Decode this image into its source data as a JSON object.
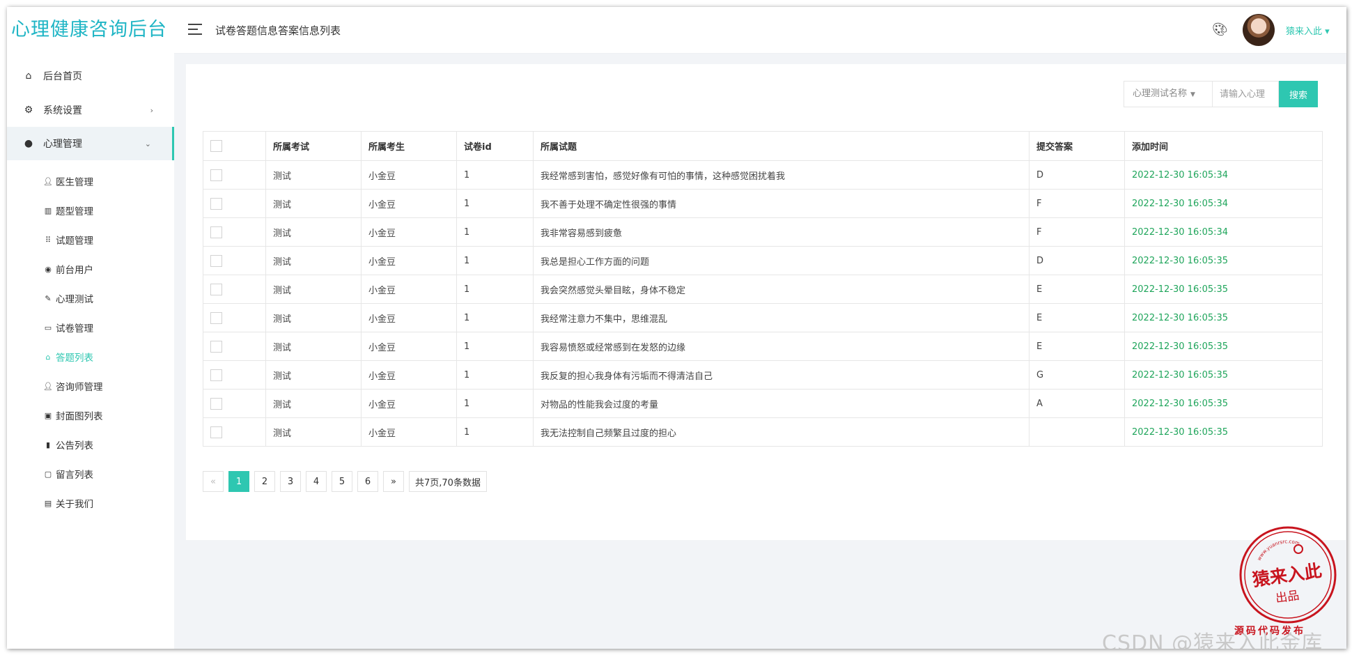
{
  "brand": "心理健康咨询后台",
  "header": {
    "page_title": "试卷答题信息答案信息列表",
    "user_name": "猿来入此 ▾"
  },
  "sidebar": {
    "items": [
      {
        "label": "后台首页",
        "icon": "home-icon"
      },
      {
        "label": "系统设置",
        "icon": "gear-icon",
        "arrow": "›"
      },
      {
        "label": "心理管理",
        "icon": "brain-icon",
        "arrow": "⌄"
      }
    ],
    "sub_items": [
      {
        "label": "医生管理",
        "icon": "user-icon"
      },
      {
        "label": "题型管理",
        "icon": "book-icon"
      },
      {
        "label": "试题管理",
        "icon": "grid-icon"
      },
      {
        "label": "前台用户",
        "icon": "user-circle-icon"
      },
      {
        "label": "心理测试",
        "icon": "pencil-icon"
      },
      {
        "label": "试卷管理",
        "icon": "clipboard-icon"
      },
      {
        "label": "答题列表",
        "icon": "list-icon"
      },
      {
        "label": "咨询师管理",
        "icon": "user-icon"
      },
      {
        "label": "封面图列表",
        "icon": "image-icon"
      },
      {
        "label": "公告列表",
        "icon": "notice-icon"
      },
      {
        "label": "留言列表",
        "icon": "message-icon"
      },
      {
        "label": "关于我们",
        "icon": "idcard-icon"
      }
    ],
    "current_sub_item": "答题列表"
  },
  "search": {
    "select_label": "心理测试名称",
    "placeholder": "请输入心理",
    "button_label": "搜索"
  },
  "table": {
    "columns": [
      "所属考试",
      "所属考生",
      "试卷id",
      "所属试题",
      "提交答案",
      "添加时间"
    ],
    "rows": [
      [
        "测试",
        "小金豆",
        "1",
        "我经常感到害怕，感觉好像有可怕的事情，这种感觉困扰着我",
        "D",
        "2022-12-30 16:05:34"
      ],
      [
        "测试",
        "小金豆",
        "1",
        "我不善于处理不确定性很强的事情",
        "F",
        "2022-12-30 16:05:34"
      ],
      [
        "测试",
        "小金豆",
        "1",
        "我非常容易感到疲惫",
        "F",
        "2022-12-30 16:05:34"
      ],
      [
        "测试",
        "小金豆",
        "1",
        "我总是担心工作方面的问题",
        "D",
        "2022-12-30 16:05:35"
      ],
      [
        "测试",
        "小金豆",
        "1",
        "我会突然感觉头晕目眩，身体不稳定",
        "E",
        "2022-12-30 16:05:35"
      ],
      [
        "测试",
        "小金豆",
        "1",
        "我经常注意力不集中，思维混乱",
        "E",
        "2022-12-30 16:05:35"
      ],
      [
        "测试",
        "小金豆",
        "1",
        "我容易愤怒或经常感到在发怒的边缘",
        "E",
        "2022-12-30 16:05:35"
      ],
      [
        "测试",
        "小金豆",
        "1",
        "我反复的担心我身体有污垢而不得清洁自己",
        "G",
        "2022-12-30 16:05:35"
      ],
      [
        "测试",
        "小金豆",
        "1",
        "对物品的性能我会过度的考量",
        "A",
        "2022-12-30 16:05:35"
      ],
      [
        "测试",
        "小金豆",
        "1",
        "我无法控制自己频繁且过度的担心",
        "",
        "2022-12-30 16:05:35"
      ]
    ]
  },
  "pagination": {
    "prev": "«",
    "pages": [
      "1",
      "2",
      "3",
      "4",
      "5",
      "6"
    ],
    "current_page": "1",
    "next": "»",
    "info": "共7页,70条数据"
  },
  "stamp": {
    "url_text": "www.yuanrsrc.com",
    "main_text": "猿来入此",
    "sub_text": "出品",
    "bottom_text": "源码代码发布"
  },
  "watermark": "CSDN @猿来入此金库",
  "colors": {
    "brand": "#1fb5c5",
    "accent": "#2ec7b1",
    "time_green": "#1fa55b",
    "stamp_red": "#c8141e"
  }
}
